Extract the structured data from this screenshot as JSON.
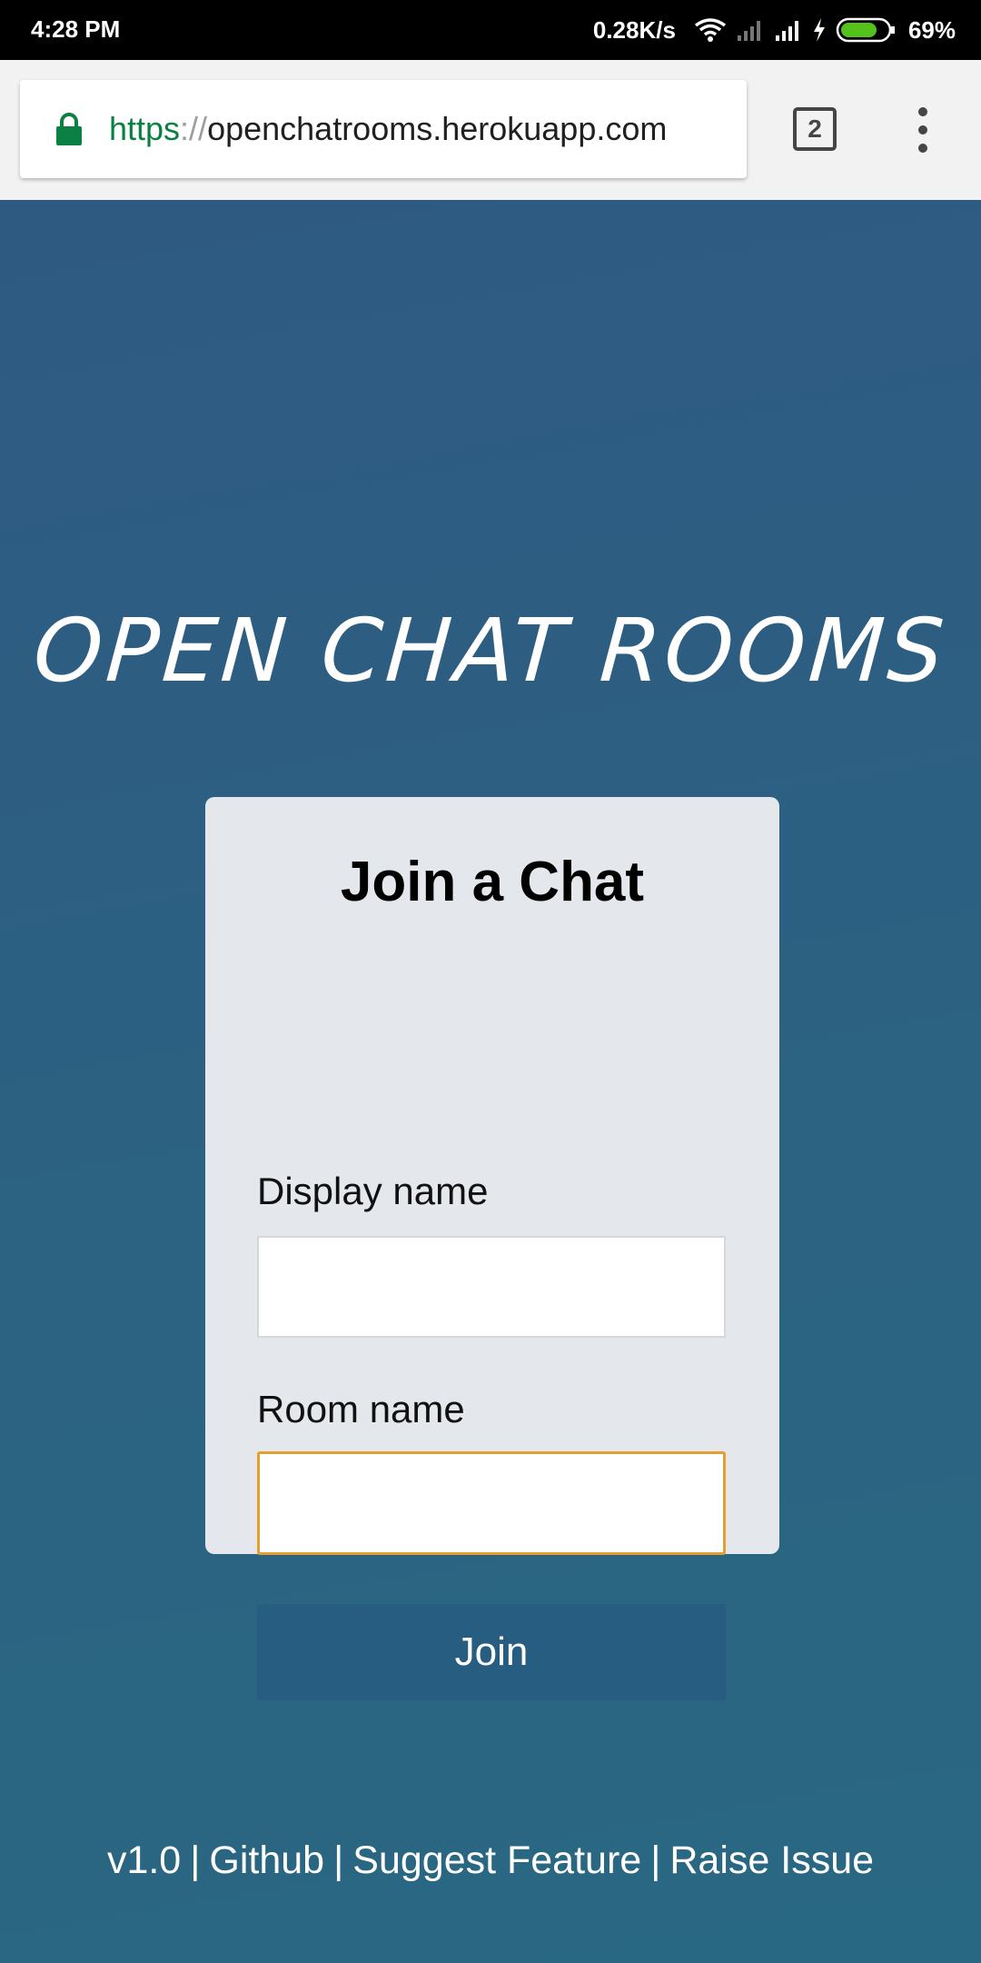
{
  "status_bar": {
    "time": "4:28 PM",
    "speed": "0.28K/s",
    "battery_percent": "69%",
    "battery_level": 0.69
  },
  "browser": {
    "url_scheme": "https",
    "url_separator": "://",
    "url_host": "openchatrooms.herokuapp.com",
    "tab_count": "2"
  },
  "page": {
    "site_title": "OPEN CHAT ROOMS",
    "card_title": "Join a Chat",
    "display_name_label": "Display name",
    "display_name_value": "",
    "room_name_label": "Room name",
    "room_name_value": "",
    "join_label": "Join"
  },
  "footer": {
    "version": "v1.0",
    "separator": "|",
    "links": [
      "Github",
      "Suggest Feature",
      "Raise Issue"
    ]
  },
  "colors": {
    "background": "#2c5f82",
    "card": "#e4e8ec",
    "button": "#285d82",
    "focus_border": "#e3a030",
    "url_scheme": "#0b8043"
  }
}
